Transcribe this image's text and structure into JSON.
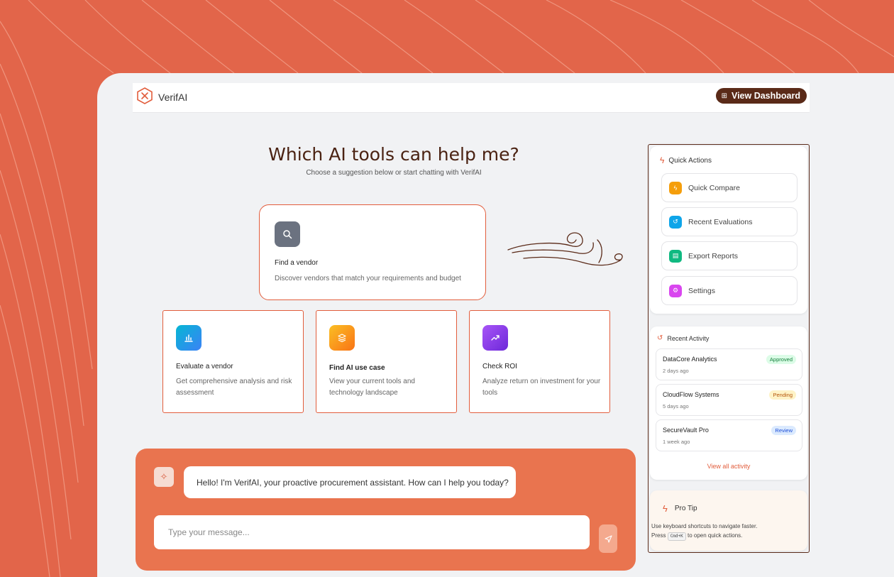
{
  "app": {
    "brand": "VerifAI"
  },
  "header": {
    "dashboard_label": "View Dashboard",
    "dashboard_icon": "grid-icon"
  },
  "main": {
    "title": "Which AI tools can help me?",
    "subtitle": "Choose a suggestion below or start chatting with VerifAI"
  },
  "cards": [
    {
      "title": "Find a vendor",
      "desc": "Discover vendors that match your requirements and budget",
      "icon": "search-icon",
      "color": "#6b7280"
    },
    {
      "title": "Evaluate a vendor",
      "desc": "Get comprehensive analysis and risk assessment",
      "icon": "bar-chart-icon",
      "color": "#0ea5e9"
    },
    {
      "title": "Find AI use case",
      "desc": "View your current tools and technology landscape",
      "icon": "layers-icon",
      "color": "#f59e0b"
    },
    {
      "title": "Check ROI",
      "desc": "Analyze return on investment for your tools",
      "icon": "trending-up-icon",
      "color": "#8b5cf6"
    }
  ],
  "chat": {
    "greeting": "Hello! I'm VerifAI, your proactive procurement assistant. How can I help you today?",
    "placeholder": "Type your message..."
  },
  "quick_actions": {
    "title": "Quick Actions",
    "items": [
      {
        "label": "Quick Compare",
        "icon": "bolt-icon",
        "color": "#f59e0b"
      },
      {
        "label": "Recent Evaluations",
        "icon": "history-icon",
        "color": "#0ea5e9"
      },
      {
        "label": "Export Reports",
        "icon": "file-icon",
        "color": "#10b981"
      },
      {
        "label": "Settings",
        "icon": "gear-icon",
        "color": "#d946ef"
      }
    ]
  },
  "recent_activity": {
    "title": "Recent Activity",
    "items": [
      {
        "name": "DataCore Analytics",
        "time": "2 days ago",
        "status": "Approved",
        "bg": "#dcfce7",
        "fg": "#15803d"
      },
      {
        "name": "CloudFlow Systems",
        "time": "5 days ago",
        "status": "Pending",
        "bg": "#fef3c7",
        "fg": "#b45309"
      },
      {
        "name": "SecureVault Pro",
        "time": "1 week ago",
        "status": "Review",
        "bg": "#dbeafe",
        "fg": "#1d4ed8"
      }
    ],
    "view_all": "View all activity"
  },
  "pro_tip": {
    "title": "Pro Tip",
    "line1": "Use keyboard shortcuts to navigate faster.",
    "press": "Press",
    "key": "Cmd+K",
    "suffix": "to open quick actions."
  }
}
